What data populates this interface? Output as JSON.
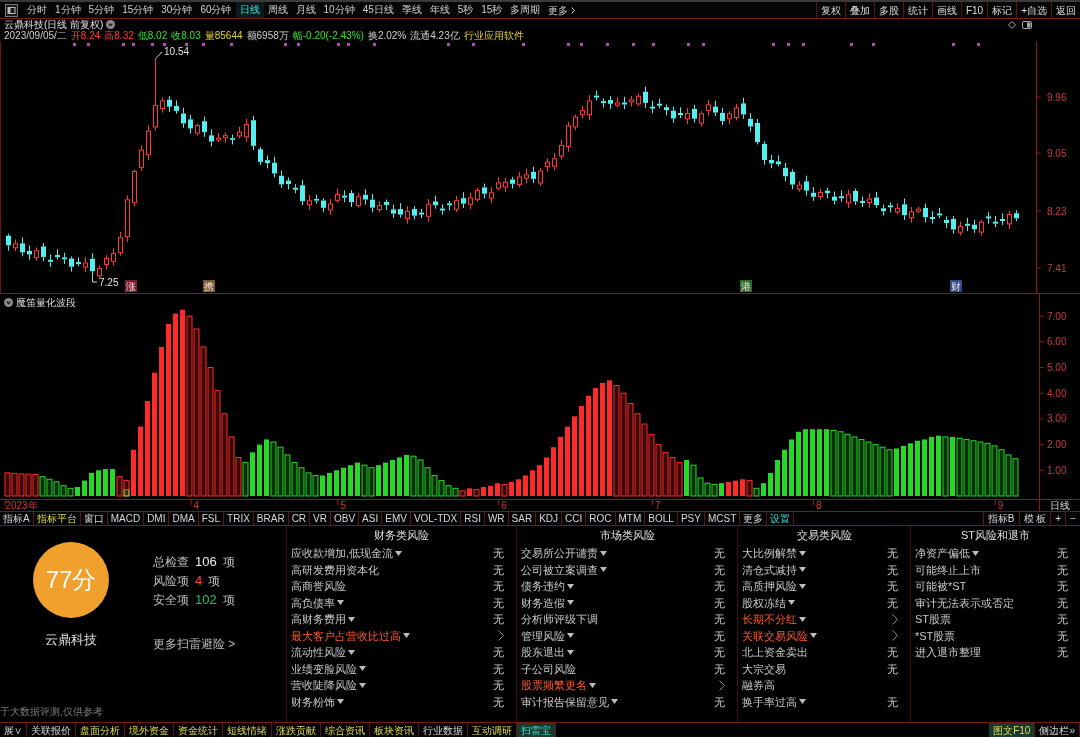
{
  "toolbar": {
    "periods": [
      {
        "label": "分时",
        "selected": false
      },
      {
        "label": "1分钟",
        "selected": false
      },
      {
        "label": "5分钟",
        "selected": false
      },
      {
        "label": "15分钟",
        "selected": false
      },
      {
        "label": "30分钟",
        "selected": false
      },
      {
        "label": "60分钟",
        "selected": false
      },
      {
        "label": "日线",
        "selected": true
      },
      {
        "label": "周线",
        "selected": false
      },
      {
        "label": "月线",
        "selected": false
      },
      {
        "label": "10分钟",
        "selected": false
      },
      {
        "label": "45日线",
        "selected": false
      },
      {
        "label": "季线",
        "selected": false
      },
      {
        "label": "年线",
        "selected": false
      },
      {
        "label": "5秒",
        "selected": false
      },
      {
        "label": "15秒",
        "selected": false
      },
      {
        "label": "多周期",
        "selected": false
      }
    ],
    "more": "更多",
    "actions": [
      "复权",
      "叠加",
      "多股",
      "统计",
      "画线",
      "F10",
      "标记",
      "+自选",
      "返回"
    ]
  },
  "chart": {
    "title": "云鼎科技(日线 前复权)",
    "quote": [
      {
        "text": "2023/09/05/二",
        "kind": "plain"
      },
      {
        "text": "开8.24",
        "kind": "up"
      },
      {
        "text": "高8.32",
        "kind": "up"
      },
      {
        "text": "低8.02",
        "kind": "down"
      },
      {
        "text": "收8.03",
        "kind": "down"
      },
      {
        "text": "量85644",
        "kind": "volume"
      },
      {
        "text": "额6958万",
        "kind": "plain"
      },
      {
        "text": "幅-0.20(-2.43%)",
        "kind": "down"
      },
      {
        "text": "换2.02%",
        "kind": "plain"
      },
      {
        "text": "流通4.23亿",
        "kind": "plain"
      },
      {
        "text": "行业应用软件",
        "kind": "volume"
      }
    ],
    "price_axis": [
      "9.96",
      "9.05",
      "8.23",
      "7.41"
    ],
    "annotations": [
      {
        "text": "10.54",
        "kind": "high"
      },
      {
        "text": "7.25",
        "kind": "low"
      }
    ],
    "markers": [
      {
        "text": "涨",
        "color": "#7a1c2c"
      },
      {
        "text": "携",
        "color": "#7a5a28"
      },
      {
        "text": "港",
        "color": "#2a6a2a"
      },
      {
        "text": "财",
        "color": "#2a4a8a"
      }
    ]
  },
  "indicator": {
    "chart_data": {
      "type": "bar",
      "title": "魔笛量化波段",
      "stacked": true,
      "categories": [
        null,
        null,
        "2023年",
        null,
        null,
        null,
        null,
        null,
        null,
        null,
        null,
        null,
        null,
        null,
        null,
        null,
        null,
        null,
        null,
        null,
        null,
        null,
        null,
        null,
        null,
        null,
        null,
        "4",
        null,
        null,
        null,
        null,
        null,
        null,
        null,
        null,
        null,
        null,
        null,
        null,
        null,
        null,
        null,
        null,
        null,
        null,
        null,
        null,
        "5",
        null,
        null,
        null,
        null,
        null,
        null,
        null,
        null,
        null,
        null,
        null,
        null,
        null,
        null,
        null,
        null,
        null,
        null,
        null,
        null,
        null,
        null,
        "6",
        null,
        null,
        null,
        null,
        null,
        null,
        null,
        null,
        null,
        null,
        null,
        null,
        null,
        null,
        null,
        null,
        null,
        null,
        null,
        null,
        null,
        "7",
        null,
        null,
        null,
        null,
        null,
        null,
        null,
        null,
        null,
        null,
        null,
        null,
        null,
        null,
        null,
        null,
        null,
        null,
        null,
        null,
        null,
        null,
        "8",
        null,
        null,
        null,
        null,
        null,
        null,
        null,
        null,
        null,
        null,
        null,
        null,
        null,
        null,
        null,
        null,
        null,
        null,
        null,
        null,
        null,
        null,
        null,
        null,
        null,
        "9",
        null,
        null
      ],
      "ylim": [
        0,
        7.86
      ],
      "yticks": [
        {
          "value": 7,
          "label": "7.00"
        },
        {
          "value": 6,
          "label": "6.00"
        },
        {
          "value": 5,
          "label": "5.00"
        },
        {
          "value": 4,
          "label": "4.00"
        },
        {
          "value": 3,
          "label": "3.00"
        },
        {
          "value": 2,
          "label": "2.00"
        },
        {
          "value": 1,
          "label": "1.00"
        }
      ],
      "series": [
        {
          "color": "#f0e020",
          "values": [
            0,
            0,
            0,
            0,
            0,
            0,
            0,
            0,
            0,
            0,
            0,
            0,
            0,
            0,
            0,
            0,
            0,
            0.25,
            0,
            0,
            0,
            0,
            0,
            0,
            0,
            0,
            0,
            0,
            0,
            0,
            0,
            0,
            0,
            0,
            0,
            0,
            0,
            0,
            0,
            0,
            0,
            0,
            0,
            0,
            0,
            0,
            0,
            0,
            0,
            0,
            0,
            0,
            0,
            0,
            0,
            0,
            0,
            0,
            0,
            0,
            0,
            0,
            0,
            0,
            0,
            0,
            0,
            0,
            0,
            0,
            0,
            0,
            0,
            0,
            0,
            0,
            0,
            0,
            0,
            0,
            0,
            0,
            0,
            0,
            0,
            0,
            0,
            0,
            0,
            0,
            0,
            0,
            0,
            0,
            0,
            0,
            0,
            0,
            0,
            0,
            0,
            0,
            0,
            0,
            0,
            0,
            0,
            0,
            0,
            0,
            0,
            0,
            0,
            0,
            0,
            0,
            0,
            0,
            0,
            0,
            0,
            0,
            0,
            0,
            0,
            0,
            0,
            0,
            0,
            0,
            0,
            0,
            0,
            0,
            0,
            0,
            0,
            0,
            0,
            0,
            0,
            0,
            0,
            0,
            0
          ]
        },
        {
          "color": "#ff2a2a",
          "values": [
            0.9,
            0.88,
            0.86,
            0.85,
            0.84,
            0,
            0,
            0,
            0,
            0,
            0,
            0,
            0,
            0,
            0,
            0,
            0.75,
            0.35,
            1.8,
            2.7,
            3.7,
            4.8,
            5.8,
            6.7,
            7.1,
            7.25,
            7.0,
            6.5,
            5.8,
            5.0,
            4.1,
            3.2,
            2.3,
            1.5,
            0,
            0,
            0,
            0,
            0,
            0,
            0,
            0,
            0,
            0,
            0,
            0,
            0,
            0,
            0,
            0,
            0,
            0,
            0,
            0,
            0,
            0,
            0,
            0,
            0,
            0,
            0,
            0,
            0,
            0,
            0,
            0.2,
            0.3,
            0.25,
            0.35,
            0.4,
            0.5,
            0.45,
            0.55,
            0.65,
            0.8,
            1.0,
            1.2,
            1.5,
            1.9,
            2.3,
            2.7,
            3.1,
            3.5,
            3.9,
            4.2,
            4.4,
            4.5,
            4.3,
            4.0,
            3.6,
            3.2,
            2.8,
            2.4,
            2.0,
            1.7,
            1.5,
            1.3,
            0,
            0,
            0,
            0,
            0,
            0,
            0.55,
            0.6,
            0.65,
            0.6,
            0,
            0,
            0,
            0,
            0,
            0,
            0,
            0,
            0,
            0,
            0,
            0,
            0,
            0,
            0,
            0,
            0,
            0,
            0,
            0,
            0,
            0,
            0,
            0,
            0,
            0,
            0,
            0,
            0,
            0,
            0,
            0,
            0,
            0,
            0,
            0,
            0,
            0
          ]
        },
        {
          "color": "#28d828",
          "values": [
            0,
            0,
            0,
            0,
            0,
            0.75,
            0.65,
            0.55,
            0.4,
            0.3,
            0.35,
            0.6,
            0.9,
            1.0,
            1.05,
            1.05,
            0,
            0,
            0,
            0,
            0,
            0,
            0,
            0,
            0,
            0,
            0,
            0,
            0,
            0,
            0,
            0,
            0,
            0,
            1.3,
            1.7,
            2.0,
            2.2,
            2.1,
            1.9,
            1.6,
            1.3,
            1.1,
            0.9,
            0.8,
            0.8,
            0.9,
            1.0,
            1.1,
            1.2,
            1.3,
            1.2,
            1.1,
            1.2,
            1.3,
            1.4,
            1.5,
            1.6,
            1.55,
            1.4,
            1.1,
            0.8,
            0.6,
            0.4,
            0.3,
            0,
            0,
            0,
            0,
            0,
            0,
            0,
            0,
            0,
            0,
            0,
            0,
            0,
            0,
            0,
            0,
            0,
            0,
            0,
            0,
            0,
            0,
            0,
            0,
            0,
            0,
            0,
            0,
            0,
            0,
            0,
            0,
            1.4,
            1.2,
            0.7,
            0.5,
            0.45,
            0.5,
            0,
            0,
            0,
            0,
            0.3,
            0.5,
            0.9,
            1.4,
            1.8,
            2.2,
            2.5,
            2.6,
            2.6,
            2.6,
            2.6,
            2.55,
            2.5,
            2.4,
            2.3,
            2.2,
            2.1,
            2.0,
            1.9,
            1.8,
            1.85,
            1.95,
            2.05,
            2.15,
            2.2,
            2.3,
            2.35,
            2.3,
            2.3,
            2.25,
            2.2,
            2.15,
            2.1,
            2.05,
            1.95,
            1.8,
            1.6,
            1.45
          ]
        }
      ]
    },
    "period_label": "日线"
  },
  "indicator_tabs": [
    {
      "label": "指标A",
      "kind": "plain"
    },
    {
      "label": "指标平台",
      "kind": "accent"
    },
    {
      "label": "窗口",
      "kind": "plain"
    },
    {
      "label": "MACD",
      "kind": "plain"
    },
    {
      "label": "DMI",
      "kind": "plain"
    },
    {
      "label": "DMA",
      "kind": "plain"
    },
    {
      "label": "FSL",
      "kind": "plain"
    },
    {
      "label": "TRIX",
      "kind": "plain"
    },
    {
      "label": "BRAR",
      "kind": "plain"
    },
    {
      "label": "CR",
      "kind": "plain"
    },
    {
      "label": "VR",
      "kind": "plain"
    },
    {
      "label": "OBV",
      "kind": "plain"
    },
    {
      "label": "ASI",
      "kind": "plain"
    },
    {
      "label": "EMV",
      "kind": "plain"
    },
    {
      "label": "VOL-TDX",
      "kind": "plain"
    },
    {
      "label": "RSI",
      "kind": "plain"
    },
    {
      "label": "WR",
      "kind": "plain"
    },
    {
      "label": "SAR",
      "kind": "plain"
    },
    {
      "label": "KDJ",
      "kind": "plain"
    },
    {
      "label": "CCI",
      "kind": "plain"
    },
    {
      "label": "ROC",
      "kind": "plain"
    },
    {
      "label": "MTM",
      "kind": "plain"
    },
    {
      "label": "BOLL",
      "kind": "plain"
    },
    {
      "label": "PSY",
      "kind": "plain"
    },
    {
      "label": "MCST",
      "kind": "plain"
    },
    {
      "label": "更多",
      "kind": "plain"
    },
    {
      "label": "设置",
      "kind": "highlight"
    }
  ],
  "indicator_tabs_right": [
    "指标B",
    "模 板",
    "+",
    "−"
  ],
  "scan": {
    "score": "77分",
    "company": "云鼎科技",
    "stats": [
      {
        "label": "总检查",
        "count": "106",
        "unit": "项",
        "kind": "total"
      },
      {
        "label": "风险项",
        "count": "4",
        "unit": "项",
        "kind": "risk"
      },
      {
        "label": "安全项",
        "count": "102",
        "unit": "项",
        "kind": "safe"
      }
    ],
    "more": "更多扫雷避险 >",
    "disclaimer": "于大数据评测,仅供参考"
  },
  "risk_groups": [
    {
      "title": "财务类风险",
      "items": [
        {
          "name": "应收款增加,低现金流",
          "dropdown": true,
          "risk": false,
          "value": "无"
        },
        {
          "name": "高研发费用资本化",
          "dropdown": false,
          "risk": false,
          "value": "无"
        },
        {
          "name": "高商誉风险",
          "dropdown": false,
          "risk": false,
          "value": "无"
        },
        {
          "name": "高负债率",
          "dropdown": true,
          "risk": false,
          "value": "无"
        },
        {
          "name": "高财务费用",
          "dropdown": true,
          "risk": false,
          "value": "无"
        },
        {
          "name": "最大客户占营收比过高",
          "dropdown": true,
          "risk": true
        },
        {
          "name": "流动性风险",
          "dropdown": true,
          "risk": false,
          "value": "无"
        },
        {
          "name": "业绩变脸风险",
          "dropdown": true,
          "risk": false,
          "value": "无"
        },
        {
          "name": "营收陡降风险",
          "dropdown": true,
          "risk": false,
          "value": "无"
        },
        {
          "name": "财务粉饰",
          "dropdown": true,
          "risk": false,
          "value": "无"
        }
      ]
    },
    {
      "title": "市场类风险",
      "items": [
        {
          "name": "交易所公开谴责",
          "dropdown": true,
          "risk": false,
          "value": "无"
        },
        {
          "name": "公司被立案调查",
          "dropdown": true,
          "risk": false,
          "value": "无"
        },
        {
          "name": "债务违约",
          "dropdown": true,
          "risk": false,
          "value": "无"
        },
        {
          "name": "财务造假",
          "dropdown": true,
          "risk": false,
          "value": "无"
        },
        {
          "name": "分析师评级下调",
          "dropdown": false,
          "risk": false,
          "value": "无"
        },
        {
          "name": "管理风险",
          "dropdown": true,
          "risk": false,
          "value": "无"
        },
        {
          "name": "股东退出",
          "dropdown": true,
          "risk": false,
          "value": "无"
        },
        {
          "name": "子公司风险",
          "dropdown": false,
          "risk": false,
          "value": "无"
        },
        {
          "name": "股票频繁更名",
          "dropdown": true,
          "risk": true
        },
        {
          "name": "审计报告保留意见",
          "dropdown": true,
          "risk": false,
          "value": "无"
        }
      ]
    },
    {
      "title": "交易类风险",
      "items": [
        {
          "name": "大比例解禁",
          "dropdown": true,
          "risk": false,
          "value": "无"
        },
        {
          "name": "清仓式减持",
          "dropdown": true,
          "risk": false,
          "value": "无"
        },
        {
          "name": "高质押风险",
          "dropdown": true,
          "risk": false,
          "value": "无"
        },
        {
          "name": "股权冻结",
          "dropdown": true,
          "risk": false,
          "value": "无"
        },
        {
          "name": "长期不分红",
          "dropdown": true,
          "risk": true
        },
        {
          "name": "关联交易风险",
          "dropdown": true,
          "risk": true
        },
        {
          "name": "北上资金卖出",
          "dropdown": false,
          "risk": false,
          "value": "无"
        },
        {
          "name": "大宗交易",
          "dropdown": false,
          "risk": false,
          "value": "无"
        },
        {
          "name": "融券高",
          "dropdown": false,
          "risk": false
        },
        {
          "name": "换手率过高",
          "dropdown": true,
          "risk": false,
          "value": "无"
        }
      ]
    },
    {
      "title": "ST风险和退市",
      "items": [
        {
          "name": "净资产偏低",
          "dropdown": true,
          "risk": false,
          "value": "无"
        },
        {
          "name": "可能终止上市",
          "dropdown": false,
          "risk": false,
          "value": "无"
        },
        {
          "name": "可能被*ST",
          "dropdown": false,
          "risk": false,
          "value": "无"
        },
        {
          "name": "审计无法表示或否定",
          "dropdown": false,
          "risk": false,
          "value": "无"
        },
        {
          "name": "ST股票",
          "dropdown": false,
          "risk": false,
          "value": "无"
        },
        {
          "name": "*ST股票",
          "dropdown": false,
          "risk": false,
          "value": "无"
        },
        {
          "name": "进入退市整理",
          "dropdown": false,
          "risk": false,
          "value": "无"
        }
      ]
    }
  ],
  "bottom_tabs": [
    {
      "label": "展∨",
      "kind": "plain",
      "selected": false
    },
    {
      "label": "关联报价",
      "kind": "plain",
      "selected": false
    },
    {
      "label": "盘面分析",
      "kind": "accent",
      "selected": false
    },
    {
      "label": "境外资金",
      "kind": "accent",
      "selected": false
    },
    {
      "label": "资金统计",
      "kind": "accent",
      "selected": false
    },
    {
      "label": "短线情绪",
      "kind": "accent",
      "selected": false
    },
    {
      "label": "涨跌贡献",
      "kind": "accent",
      "selected": false
    },
    {
      "label": "综合资讯",
      "kind": "accent",
      "selected": false
    },
    {
      "label": "板块资讯",
      "kind": "accent",
      "selected": false
    },
    {
      "label": "行业数据",
      "kind": "plain",
      "selected": false
    },
    {
      "label": "互动调研",
      "kind": "accent",
      "selected": false
    },
    {
      "label": "扫雷宝",
      "kind": "highlight",
      "selected": true
    }
  ],
  "bottom_right": [
    {
      "label": "图文F10",
      "kind": "accent",
      "selected": true
    },
    {
      "label": "侧边栏»",
      "kind": "plain",
      "selected": false
    }
  ]
}
